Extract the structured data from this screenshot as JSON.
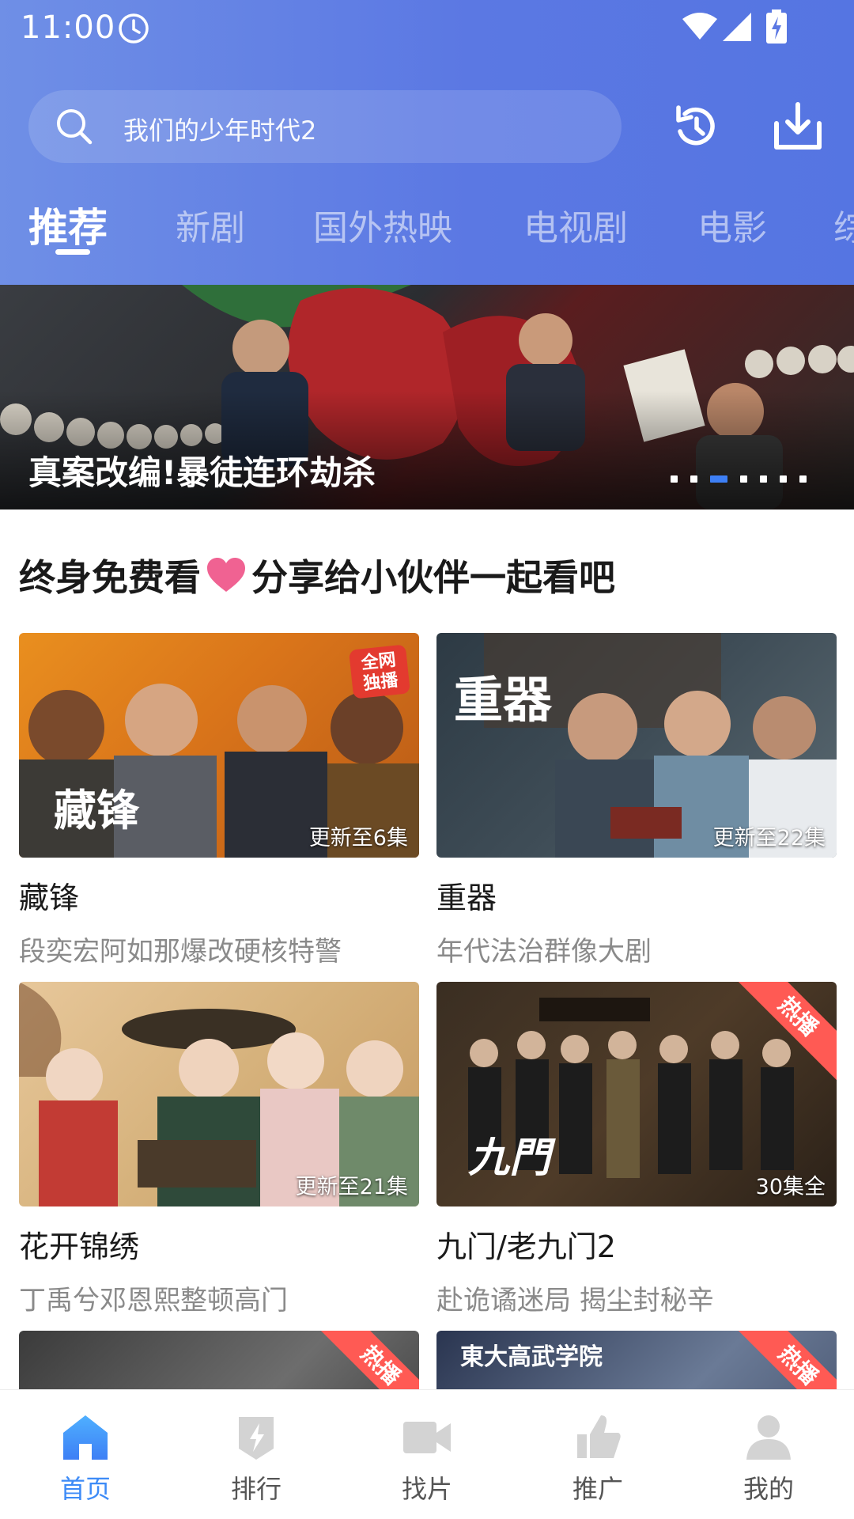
{
  "status_bar": {
    "time": "11:00"
  },
  "search": {
    "placeholder": "我们的少年时代2"
  },
  "tabs": [
    {
      "label": "推荐",
      "active": true
    },
    {
      "label": "新剧"
    },
    {
      "label": "国外热映"
    },
    {
      "label": "电视剧"
    },
    {
      "label": "电影"
    },
    {
      "label": "综"
    }
  ],
  "banner": {
    "title": "真案改编!暴徒连环劫杀",
    "dots_count": 7,
    "active_dot": 2
  },
  "section": {
    "title_part1": "终身免费看",
    "title_part2": "分享给小伙伴一起看吧"
  },
  "cards": [
    {
      "title": "藏锋",
      "subtitle": "段奕宏阿如那爆改硬核特警",
      "episodes": "更新至6集",
      "badge": "全网独播",
      "logo": "藏锋"
    },
    {
      "title": "重器",
      "subtitle": "年代法治群像大剧",
      "episodes": "更新至22集",
      "logo": "重器"
    },
    {
      "title": "花开锦绣",
      "subtitle": "丁禹兮邓恩熙整顿高门",
      "episodes": "更新至21集"
    },
    {
      "title": "九门/老九门2",
      "subtitle": "赴诡谲迷局 揭尘封秘辛",
      "episodes": "30集全",
      "ribbon": "热播",
      "logo": "九門"
    },
    {
      "ribbon": "热播"
    },
    {
      "ribbon": "热播",
      "logo": "東大高武学院"
    }
  ],
  "bottom_nav": [
    {
      "label": "首页",
      "icon": "home-icon",
      "active": true
    },
    {
      "label": "排行",
      "icon": "ranking-icon"
    },
    {
      "label": "找片",
      "icon": "video-camera-icon"
    },
    {
      "label": "推广",
      "icon": "thumbs-up-icon"
    },
    {
      "label": "我的",
      "icon": "user-icon"
    }
  ],
  "colors": {
    "header": "#5b78e3",
    "accent": "#3d8bf7",
    "ribbon": "#ff5a54",
    "heart": "#f06292"
  }
}
